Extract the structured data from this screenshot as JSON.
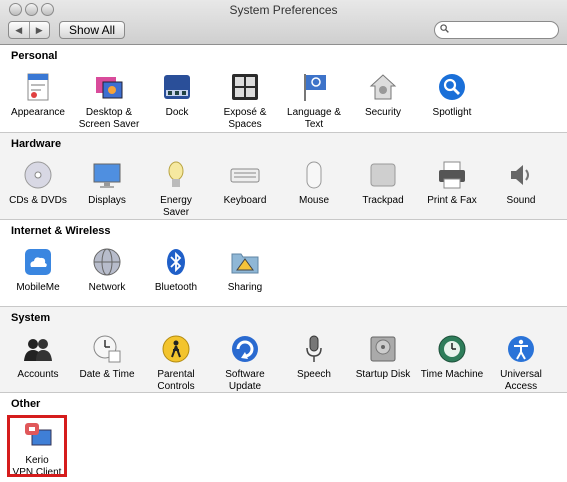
{
  "window": {
    "title": "System Preferences"
  },
  "toolbar": {
    "back": "◀",
    "forward": "▶",
    "show_all_label": "Show All",
    "search_placeholder": ""
  },
  "sections": {
    "personal": {
      "title": "Personal",
      "items": [
        "Appearance",
        "Desktop &\nScreen Saver",
        "Dock",
        "Exposé &\nSpaces",
        "Language &\nText",
        "Security",
        "Spotlight"
      ]
    },
    "hardware": {
      "title": "Hardware",
      "items": [
        "CDs & DVDs",
        "Displays",
        "Energy\nSaver",
        "Keyboard",
        "Mouse",
        "Trackpad",
        "Print & Fax",
        "Sound"
      ]
    },
    "internet": {
      "title": "Internet & Wireless",
      "items": [
        "MobileMe",
        "Network",
        "Bluetooth",
        "Sharing"
      ]
    },
    "system": {
      "title": "System",
      "items": [
        "Accounts",
        "Date & Time",
        "Parental\nControls",
        "Software\nUpdate",
        "Speech",
        "Startup Disk",
        "Time Machine",
        "Universal\nAccess"
      ]
    },
    "other": {
      "title": "Other",
      "items": [
        "Kerio\nVPN Client"
      ]
    }
  },
  "colors": {
    "highlight_border": "#d51c1c",
    "spotlight_blue": "#1a6fd8"
  }
}
